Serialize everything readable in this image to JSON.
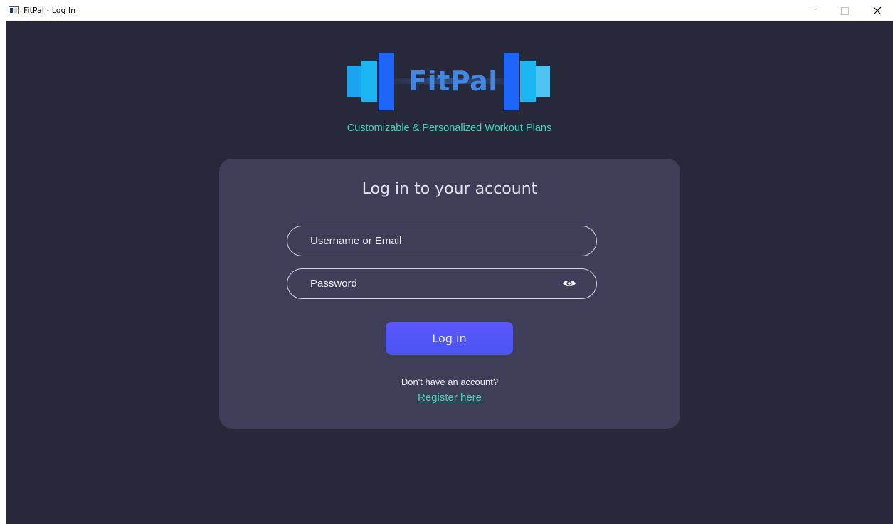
{
  "window": {
    "title": "FitPal - Log In"
  },
  "logo": {
    "text": "FitPal"
  },
  "tagline": "Customizable & Personalized Workout Plans",
  "login": {
    "heading": "Log in to your account",
    "username_placeholder": "Username or Email",
    "password_placeholder": "Password",
    "login_button": "Log in",
    "no_account_text": "Don't have an account?",
    "register_link": "Register here"
  },
  "icons": {
    "app": "window-app-icon",
    "minimize": "minimize-icon",
    "maximize": "maximize-icon",
    "close": "close-icon",
    "password_toggle": "eye-icon"
  },
  "colors": {
    "background": "#272839",
    "card": "#3f3e59",
    "accent_teal": "#3fd6be",
    "button": "#5252f8",
    "logo_blue": "#1e6bfa",
    "logo_light_blue": "#4ec3f0",
    "logo_text": "#4487e0"
  }
}
